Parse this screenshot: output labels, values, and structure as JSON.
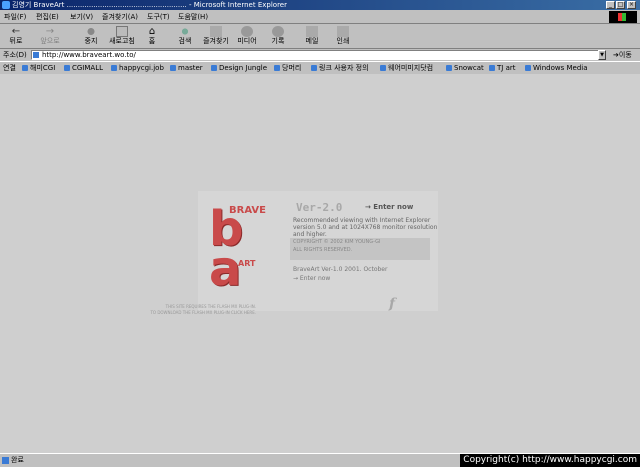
{
  "window": {
    "title": "김영기 BraveArt ...................................................... - Microsoft Internet Explorer"
  },
  "menu": [
    "파일(F)",
    "편집(E)",
    "보기(V)",
    "즐겨찾기(A)",
    "도구(T)",
    "도움말(H)"
  ],
  "toolbar": {
    "back": "뒤로",
    "forward": "앞으로",
    "stop": "중지",
    "refresh": "새로고침",
    "home": "홈",
    "search": "검색",
    "favorites": "즐겨찾기",
    "media": "미디어",
    "history": "기록",
    "mail": "메일",
    "print": "인쇄"
  },
  "address": {
    "label": "주소(D)",
    "url": "http://www.braveart.wo.to/",
    "go": "이동"
  },
  "links": {
    "label": "연결",
    "items": [
      "해미CGI",
      "CGIMALL",
      "happycgi.job",
      "master",
      "Design Jungle",
      "당머리",
      "링크 사용자 정의",
      "웨어미미지닷컴",
      "Snowcat",
      "TJ art",
      "Windows Media"
    ]
  },
  "splash": {
    "logo_brave": "BRAVE",
    "logo_b": "b",
    "logo_a": "a",
    "logo_art": "ART",
    "version": "Ver-2.0",
    "enter_now": "→ Enter now",
    "recommend": "Recommended viewing with Internet Explorer version 5.0 and at 1024X768 monitor resolution and higher.",
    "copyright_1": "COPYRIGHT © 2002 KIM YOUNG-GI",
    "copyright_2": "ALL RIGHTS RESERVED.",
    "braveart_ver": "BraveArt Ver-1.0  2001. October",
    "enter_now_2": "→ Enter now",
    "flash_note_1": "THIS SITE REQUIRES THE FLASH MX PLUG-IN.",
    "flash_note_2": "TO DOWNLOAD THE FLASH MX PLUG-IN CLICK HERE.",
    "flash_icon": "f"
  },
  "status": {
    "text": "완료",
    "copyright": "Copyright(c) http://www.happycgi.com"
  }
}
